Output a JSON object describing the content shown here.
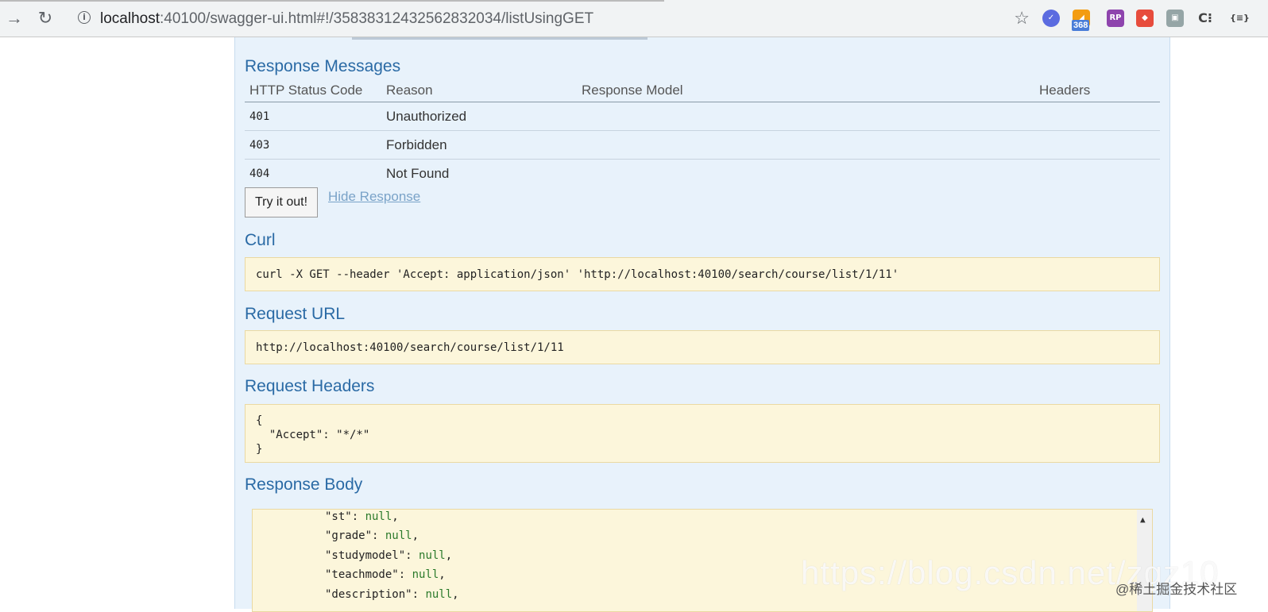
{
  "browser": {
    "url_host": "localhost",
    "url_rest": ":40100/swagger-ui.html#!/35838312432562832034/listUsingGET",
    "extension_badge": "368"
  },
  "response_messages": {
    "title": "Response Messages",
    "columns": [
      "HTTP Status Code",
      "Reason",
      "Response Model",
      "Headers"
    ],
    "rows": [
      {
        "code": "401",
        "reason": "Unauthorized"
      },
      {
        "code": "403",
        "reason": "Forbidden"
      },
      {
        "code": "404",
        "reason": "Not Found"
      }
    ]
  },
  "actions": {
    "try_label": "Try it out!",
    "hide_label": "Hide Response"
  },
  "curl": {
    "title": "Curl",
    "command": "curl -X GET --header 'Accept: application/json' 'http://localhost:40100/search/course/list/1/11'"
  },
  "request_url": {
    "title": "Request URL",
    "value": "http://localhost:40100/search/course/list/1/11"
  },
  "request_headers": {
    "title": "Request Headers",
    "lines": [
      "{",
      "  \"Accept\": \"*/*\"",
      "}"
    ]
  },
  "response_body": {
    "title": "Response Body",
    "lines": [
      {
        "key": "\"st\"",
        "value": "null"
      },
      {
        "key": "\"grade\"",
        "value": "null"
      },
      {
        "key": "\"studymodel\"",
        "value": "null"
      },
      {
        "key": "\"teachmode\"",
        "value": "null"
      },
      {
        "key": "\"description\"",
        "value": "null"
      }
    ]
  },
  "watermark": {
    "text": "https://blog.csdn.net/zgz10",
    "text2": "@稀土掘金技术社区"
  }
}
